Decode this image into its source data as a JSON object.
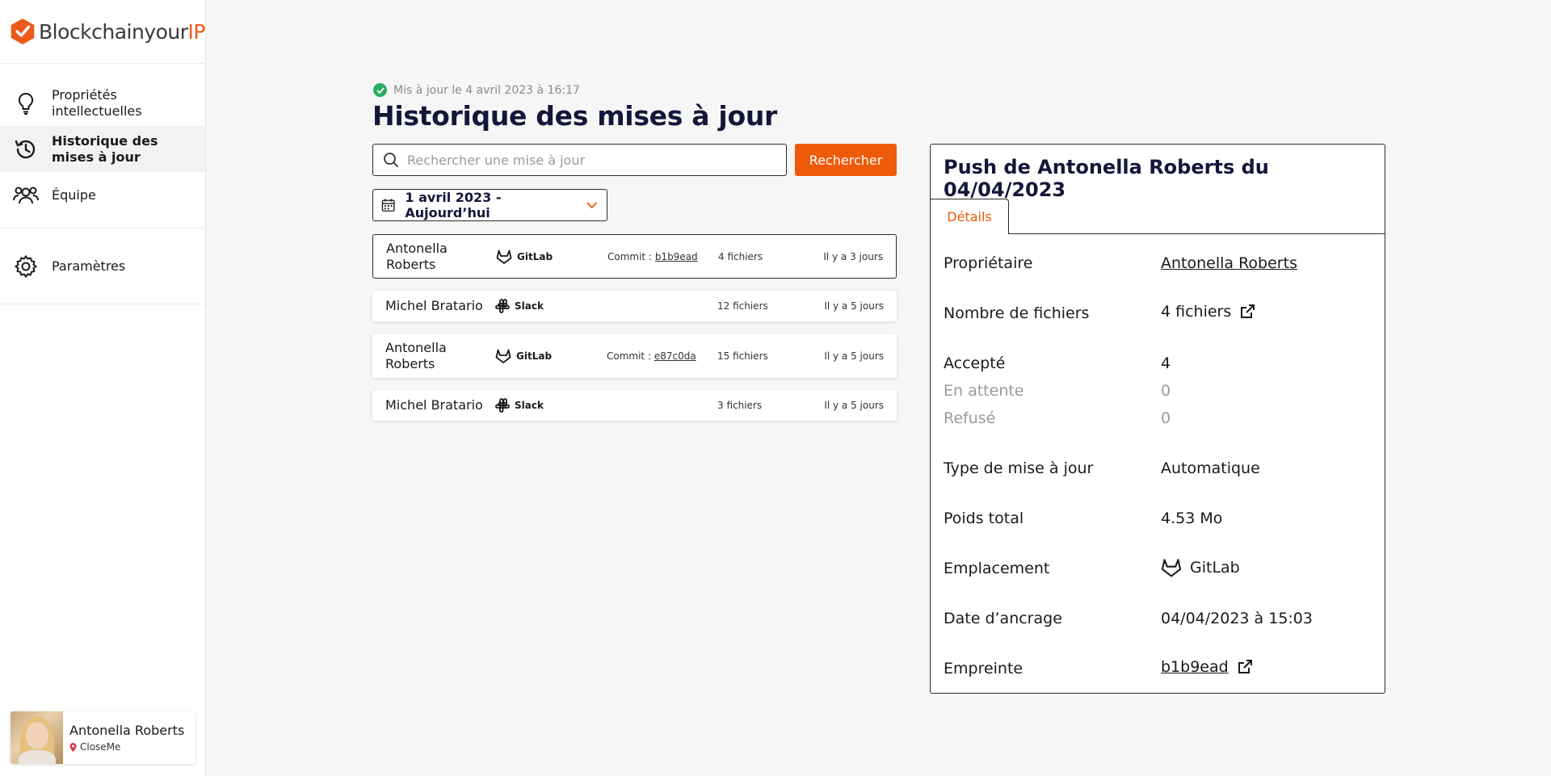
{
  "brand": {
    "name_main": "Blockchainyour",
    "name_accent": "IP",
    "accent_color": "#ee5a0a",
    "title_color": "#14163a"
  },
  "sidebar": {
    "items": [
      {
        "label": "Propriétés intellectuelles",
        "icon": "lightbulb-icon"
      },
      {
        "label": "Historique des mises à jour",
        "icon": "history-icon",
        "active": true
      },
      {
        "label": "Équipe",
        "icon": "team-icon"
      },
      {
        "label": "Paramètres",
        "icon": "gear-icon"
      }
    ],
    "user": {
      "name": "Antonella Roberts",
      "org": "CloseMe"
    }
  },
  "main": {
    "updated_text": "Mis à jour le 4 avril 2023 à 16:17",
    "title": "Historique des mises à jour",
    "search_placeholder": "Rechercher une mise à jour",
    "search_button": "Rechercher",
    "date_range": "1 avril 2023 - Aujourd’hui",
    "rows": [
      {
        "author": "Antonella Roberts",
        "source": "GitLab",
        "commit_label": "Commit : ",
        "commit_hash": "b1b9ead",
        "files": "4 fichiers",
        "when": "Il y a 3 jours"
      },
      {
        "author": "Michel Bratario",
        "source": "Slack",
        "commit_label": "",
        "commit_hash": "",
        "files": "12 fichiers",
        "when": "Il y a 5 jours"
      },
      {
        "author": "Antonella Roberts",
        "source": "GitLab",
        "commit_label": "Commit : ",
        "commit_hash": "e87c0da",
        "files": "15 fichiers",
        "when": "Il y a 5 jours"
      },
      {
        "author": "Michel Bratario",
        "source": "Slack",
        "commit_label": "",
        "commit_hash": "",
        "files": "3 fichiers",
        "when": "Il y a 5 jours"
      }
    ]
  },
  "panel": {
    "title": "Push de Antonella Roberts du 04/04/2023",
    "tab": "Détails",
    "owner_label": "Propriétaire",
    "owner_value": "Antonella Roberts",
    "files_label": "Nombre de fichiers",
    "files_value": "4 fichiers",
    "accepted_label": "Accepté",
    "accepted_value": "4",
    "pending_label": "En attente",
    "pending_value": "0",
    "refused_label": "Refusé",
    "refused_value": "0",
    "type_label": "Type de mise à jour",
    "type_value": "Automatique",
    "weight_label": "Poids total",
    "weight_value": "4.53 Mo",
    "location_label": "Emplacement",
    "location_value": "GitLab",
    "date_label": "Date d’ancrage",
    "date_value": "04/04/2023 à 15:03",
    "fingerprint_label": "Empreinte",
    "fingerprint_value": "b1b9ead"
  }
}
